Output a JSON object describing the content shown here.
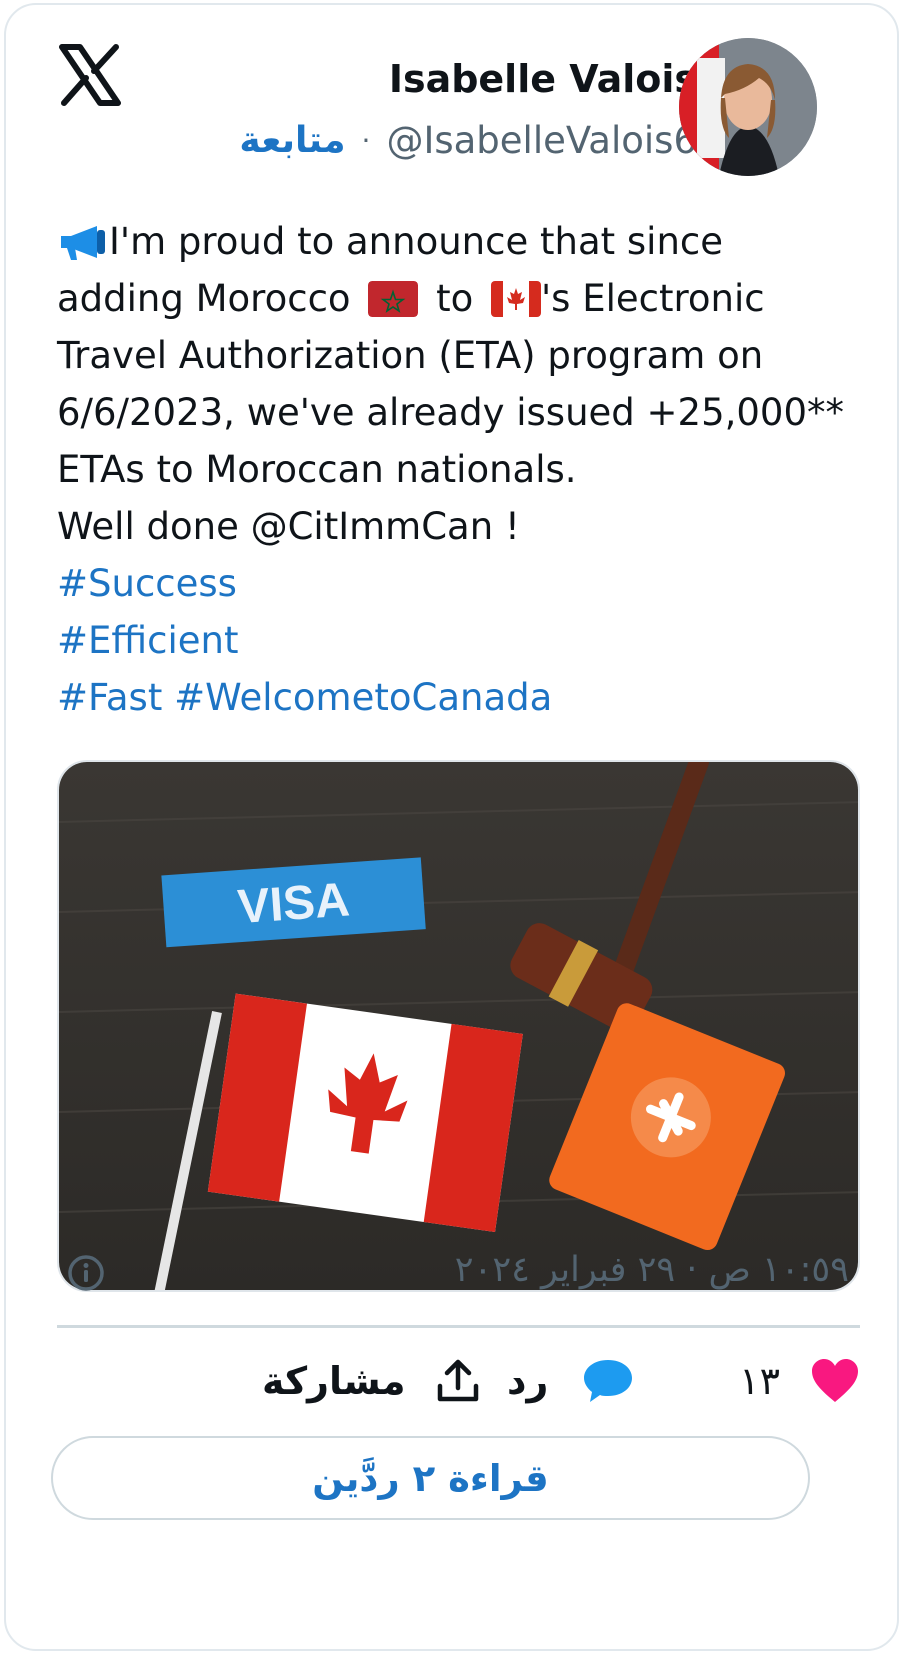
{
  "author": {
    "name": "Isabelle Valois",
    "handle": "@IsabelleValois6",
    "follow_label": "متابعة"
  },
  "tweet": {
    "lines": [
      {
        "pre": "I'm proud to announce that since"
      },
      {
        "pre": "adding Morocco",
        "mid": "to",
        "post": "'s Electronic"
      },
      {
        "pre": "Travel Authorization (ETA) program on"
      },
      {
        "pre": "6/6/2023, we've already issued +25,000**"
      },
      {
        "pre": "ETAs to Moroccan nationals."
      },
      {
        "pre": "Well done @CitImmCan !"
      }
    ],
    "hashtags": [
      "#Success",
      "#Efficient",
      "#Fast",
      "#WelcomeToCanada"
    ],
    "hashtag_display": [
      "#Success",
      "#Efficient",
      "#Fast #WelcometoCanada"
    ]
  },
  "media": {
    "visa_label": "VISA"
  },
  "meta": {
    "timestamp": "١٠:٥٩ ص · ٢٩ فبراير ٢٠٢٤"
  },
  "actions": {
    "likes_count": "١٣",
    "reply_label": "رد",
    "share_label": "مشاركة"
  },
  "read_replies_label": "قراءة ٢ ردَّين",
  "colors": {
    "link": "#1d74c4",
    "like": "#f91880",
    "reply_bubble": "#1d9bf0"
  }
}
